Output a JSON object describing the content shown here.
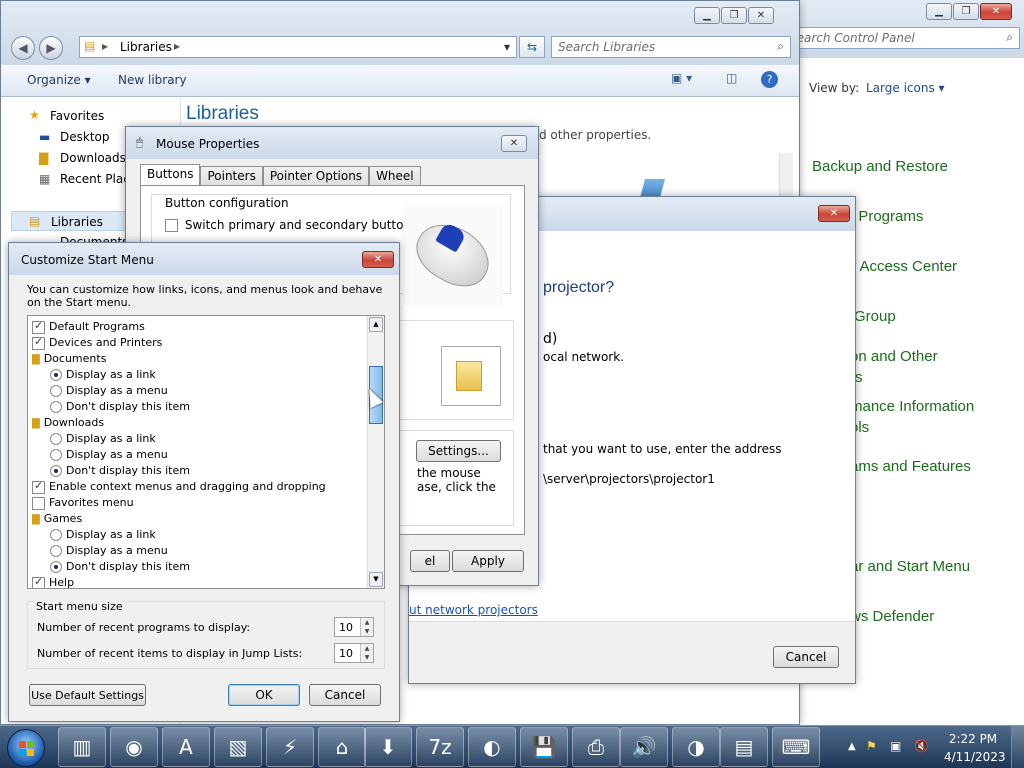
{
  "control_panel": {
    "search_placeholder": "Search Control Panel",
    "view_by_label": "View by:",
    "view_by_value": "Large icons",
    "items": [
      "Backup and Restore",
      "t Programs",
      "f Access Center",
      "Group",
      "on and Other",
      "rs",
      "mance Information",
      "ols",
      "ams and Features",
      "ar and Start Menu",
      "ws Defender"
    ]
  },
  "libraries": {
    "address": "Libraries",
    "search_placeholder": "Search Libraries",
    "toolbar": {
      "organize": "Organize",
      "new_library": "New library"
    },
    "nav": {
      "favorites": "Favorites",
      "desktop": "Desktop",
      "downloads": "Downloads",
      "recent": "Recent Places",
      "libraries": "Libraries",
      "documents": "Documents"
    },
    "heading": "Libraries",
    "subtext": "d other properties."
  },
  "projector": {
    "heading": "projector?",
    "line1": "d)",
    "line2": "ocal network.",
    "line3": "that you want to use, enter the address",
    "path": "\\server\\projectors\\projector1",
    "link": "ut network projectors",
    "cancel": "Cancel"
  },
  "mouse": {
    "title": "Mouse Properties",
    "tabs": [
      "Buttons",
      "Pointers",
      "Pointer Options",
      "Wheel"
    ],
    "group_label": "Button configuration",
    "switch_label": "Switch primary and secondary buttons",
    "settings": "Settings...",
    "lock_text1": "the mouse",
    "lock_text2": "ase, click the",
    "cancel_partial": "el",
    "apply": "Apply"
  },
  "start_menu": {
    "title": "Customize Start Menu",
    "description": "You can customize how links, icons, and menus look and behave on the Start menu.",
    "list": [
      {
        "kind": "check",
        "checked": true,
        "label": "Default Programs"
      },
      {
        "kind": "check",
        "checked": true,
        "label": "Devices and Printers"
      },
      {
        "kind": "group",
        "label": "Documents"
      },
      {
        "kind": "radio",
        "checked": true,
        "label": "Display as a link"
      },
      {
        "kind": "radio",
        "checked": false,
        "label": "Display as a menu"
      },
      {
        "kind": "radio",
        "checked": false,
        "label": "Don't display this item"
      },
      {
        "kind": "group",
        "label": "Downloads"
      },
      {
        "kind": "radio",
        "checked": false,
        "label": "Display as a link"
      },
      {
        "kind": "radio",
        "checked": false,
        "label": "Display as a menu"
      },
      {
        "kind": "radio",
        "checked": true,
        "label": "Don't display this item"
      },
      {
        "kind": "check",
        "checked": true,
        "label": "Enable context menus and dragging and dropping"
      },
      {
        "kind": "check",
        "checked": false,
        "label": "Favorites menu"
      },
      {
        "kind": "group",
        "label": "Games"
      },
      {
        "kind": "radio",
        "checked": false,
        "label": "Display as a link"
      },
      {
        "kind": "radio",
        "checked": false,
        "label": "Display as a menu"
      },
      {
        "kind": "radio",
        "checked": true,
        "label": "Don't display this item"
      },
      {
        "kind": "check",
        "checked": true,
        "label": "Help"
      }
    ],
    "size_group": "Start menu size",
    "recent_programs_label": "Number of recent programs to display:",
    "recent_programs_value": "10",
    "recent_items_label": "Number of recent items to display in Jump Lists:",
    "recent_items_value": "10",
    "default_btn": "Use Default Settings",
    "ok": "OK",
    "cancel": "Cancel"
  },
  "taskbar": {
    "time": "2:22 PM",
    "date": "4/11/2023"
  }
}
